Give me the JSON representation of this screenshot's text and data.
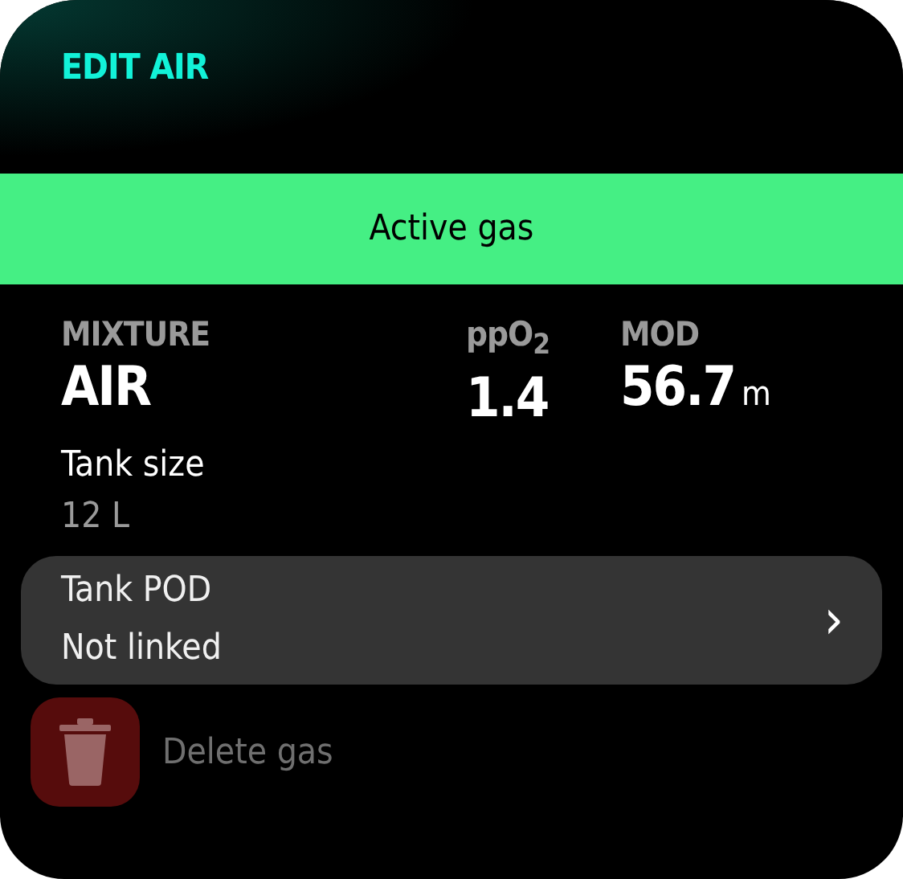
{
  "header": {
    "title": "EDIT AIR"
  },
  "status_banner": {
    "label": "Active gas"
  },
  "stats": [
    {
      "label": "MIXTURE",
      "value": "AIR"
    },
    {
      "label": "ppO$_{2}$",
      "value": "1.4"
    },
    {
      "label": "MOD",
      "value": "56.7",
      "unit": "m"
    }
  ],
  "tank_size": {
    "label": "Tank size",
    "value": "12 L"
  },
  "tank_pod": {
    "label": "Tank POD",
    "value": "Not linked",
    "chevron": "›"
  },
  "delete_action": {
    "label": "Delete gas",
    "disabled": true
  }
}
